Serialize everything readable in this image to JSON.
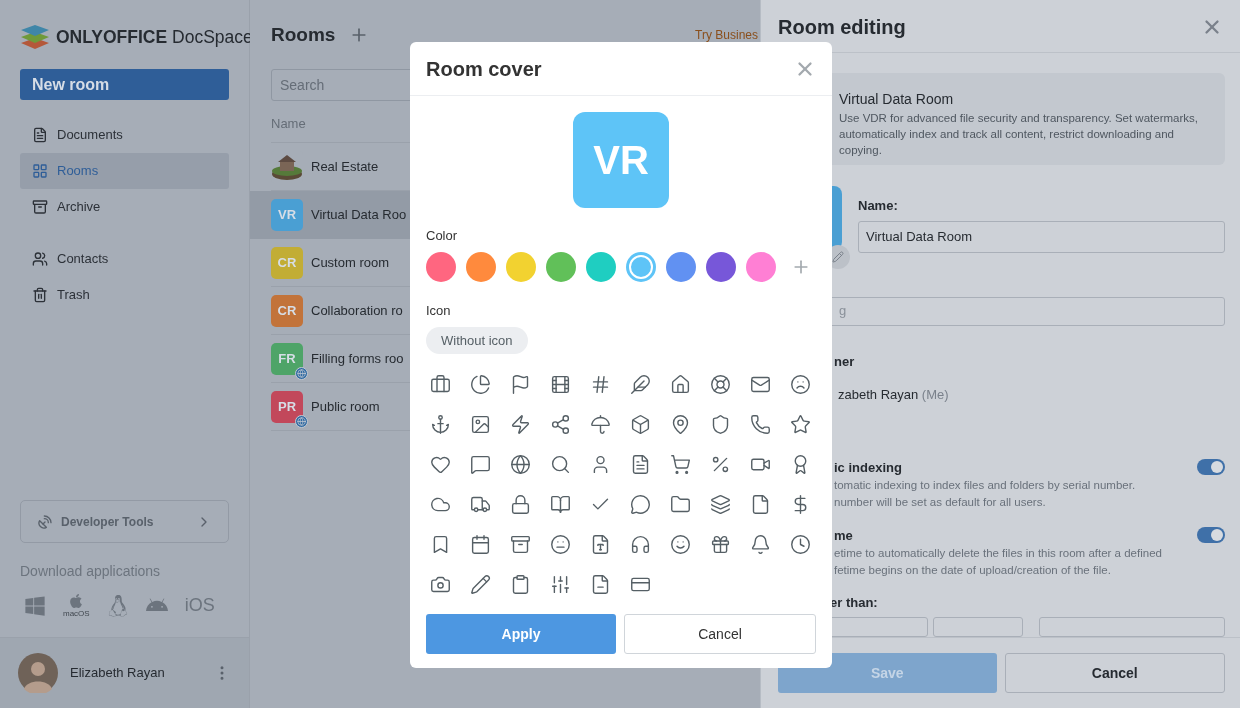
{
  "sidebar": {
    "logo": {
      "brand": "ONLYOFFICE",
      "product": "DocSpace"
    },
    "new_room_button": "New room",
    "nav_groups": [
      [
        {
          "label": "Documents",
          "selected": false
        },
        {
          "label": "Rooms",
          "selected": true
        },
        {
          "label": "Archive",
          "selected": false
        }
      ],
      [
        {
          "label": "Contacts",
          "selected": false
        },
        {
          "label": "Trash",
          "selected": false
        }
      ]
    ],
    "developer_tools": "Developer Tools",
    "download": {
      "title": "Download applications",
      "macos_label": "macOS",
      "ios_label": "iOS"
    },
    "user": {
      "name": "Elizabeth Rayan"
    }
  },
  "rooms": {
    "title": "Rooms",
    "promo": "Try Busines",
    "search": {
      "placeholder": "Search"
    },
    "column": "Name",
    "items": [
      {
        "kind": "picture",
        "name": "Real Estate",
        "selected": false
      },
      {
        "kind": "initials",
        "initials": "VR",
        "color": "#4a9fd3",
        "name": "Virtual Data Roo",
        "selected": true,
        "public": false
      },
      {
        "kind": "initials",
        "initials": "CR",
        "color": "#c2ad35",
        "name": "Custom room",
        "selected": false,
        "public": false
      },
      {
        "kind": "initials",
        "initials": "CR",
        "color": "#c2733a",
        "name": "Collaboration ro",
        "selected": false,
        "public": false
      },
      {
        "kind": "initials",
        "initials": "FR",
        "color": "#4ea468",
        "name": "Filling forms roo",
        "selected": false,
        "public": true
      },
      {
        "kind": "initials",
        "initials": "PR",
        "color": "#c2485b",
        "name": "Public room",
        "selected": false,
        "public": true
      }
    ]
  },
  "room_editing": {
    "title": "Room editing",
    "type_card": {
      "title": "Virtual Data Room",
      "description": "Use VDR for advanced file security and transparency. Set watermarks, automatically index and track all content, restrict downloading and copying."
    },
    "name_label": "Name:",
    "name_value": "Virtual Data Room",
    "tags_placeholder": "g",
    "owner_label": "ner",
    "owner_name": "zabeth Rayan",
    "owner_me": "(Me)",
    "settings": [
      {
        "title": "ic indexing",
        "description": [
          "tomatic indexing to index files and folders by serial number.",
          "number will be set as default for all users."
        ],
        "on": true
      },
      {
        "title": "me",
        "description": [
          "etime to automatically delete the files in this room after a defined",
          "fetime begins on the date of upload/creation of the file."
        ],
        "on": true
      }
    ],
    "older_label": "er than:",
    "save": "Save",
    "cancel": "Cancel"
  },
  "cover_dialog": {
    "title": "Room cover",
    "preview": "VR",
    "color_label": "Color",
    "colors": [
      {
        "color": "#ff6680",
        "selected": false
      },
      {
        "color": "#ff8a3d",
        "selected": false
      },
      {
        "color": "#f2d230",
        "selected": false
      },
      {
        "color": "#61c059",
        "selected": false
      },
      {
        "color": "#1fcec1",
        "selected": false
      },
      {
        "color": "#5ec4f7",
        "selected": true
      },
      {
        "color": "#6191f2",
        "selected": false
      },
      {
        "color": "#7757d9",
        "selected": false
      },
      {
        "color": "#ff7fd4",
        "selected": false
      }
    ],
    "icon_label": "Icon",
    "without_icon": "Without icon",
    "apply": "Apply",
    "cancel": "Cancel"
  }
}
